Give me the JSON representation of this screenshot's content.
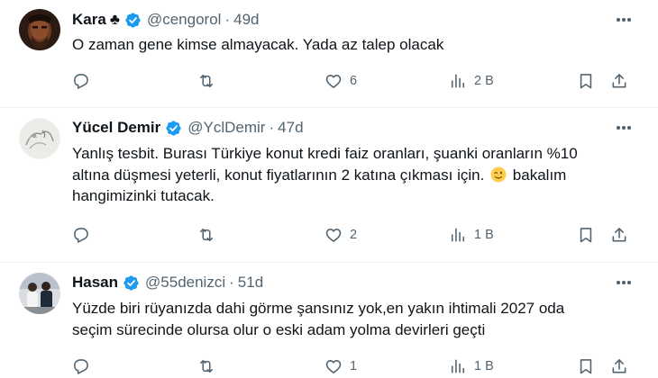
{
  "tweets": [
    {
      "name": "Kara",
      "name_suffix": "♣",
      "handle": "@cengorol",
      "separator": "·",
      "time": "49d",
      "text": "O zaman gene kimse almayacak. Yada az talep olacak",
      "likes": "6",
      "views": "2 B"
    },
    {
      "name": "Yücel Demir",
      "handle": "@YclDemir",
      "separator": "·",
      "time": "47d",
      "text_line1": "Yanlış tesbit. Burası Türkiye konut kredi faiz oranları, şuanki oranların %10",
      "text_line2a": "altına düşmesi yeterli, konut fiyatlarının 2 katına çıkması için.",
      "text_line2b": "bakalım",
      "text_line3": "hangimizinki tutacak.",
      "likes": "2",
      "views": "1 B"
    },
    {
      "name": "Hasan",
      "handle": "@55denizci",
      "separator": "·",
      "time": "51d",
      "text_line1": "Yüzde biri rüyanızda dahi görme şansınız yok,en yakın ihtimali 2027 oda",
      "text_line2": "seçim sürecinde olursa olur o eski adam yolma devirleri geçti",
      "likes": "1",
      "views": "1 B"
    }
  ],
  "icons": {
    "reply": "reply-icon",
    "retweet": "retweet-icon",
    "like": "heart-icon",
    "views": "views-icon",
    "bookmark": "bookmark-icon",
    "share": "share-icon",
    "verified": "verified-badge-icon",
    "more": "more-options-icon",
    "wink": "wink-emoji-icon"
  },
  "colors": {
    "verified": "#1d9bf0",
    "secondary_text": "#536471",
    "primary_text": "#0f1419",
    "divider": "#eff3f4"
  }
}
